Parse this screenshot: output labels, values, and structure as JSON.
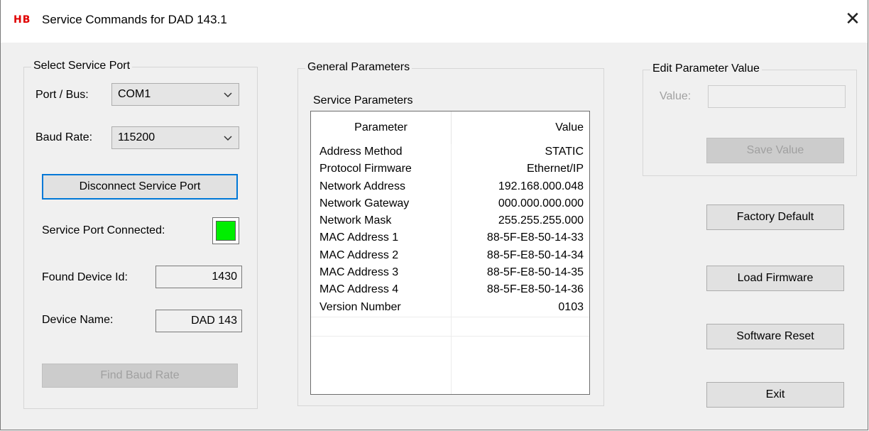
{
  "window": {
    "logo": "HB",
    "title": "Service Commands for DAD 143.1",
    "close_glyph": "✕"
  },
  "select_port": {
    "group_title": "Select Service Port",
    "port_label": "Port / Bus:",
    "port_value": "COM1",
    "baud_label": "Baud Rate:",
    "baud_value": "115200",
    "disconnect_label": "Disconnect Service Port",
    "connected_label": "Service Port Connected:",
    "connected_color": "#00ee00",
    "device_id_label": "Found Device Id:",
    "device_id_value": "1430",
    "device_name_label": "Device Name:",
    "device_name_value": "DAD 143",
    "find_baud_label": "Find Baud Rate"
  },
  "general": {
    "group_title": "General Parameters",
    "list_title": "Service Parameters",
    "columns": {
      "parameter": "Parameter",
      "value": "Value"
    },
    "rows": [
      {
        "parameter": "Address Method",
        "value": "STATIC"
      },
      {
        "parameter": "Protocol Firmware",
        "value": "Ethernet/IP"
      },
      {
        "parameter": "Network Address",
        "value": "192.168.000.048"
      },
      {
        "parameter": "Network Gateway",
        "value": "000.000.000.000"
      },
      {
        "parameter": "Network Mask",
        "value": "255.255.255.000"
      },
      {
        "parameter": "MAC Address 1",
        "value": "88-5F-E8-50-14-33"
      },
      {
        "parameter": "MAC Address 2",
        "value": "88-5F-E8-50-14-34"
      },
      {
        "parameter": "MAC Address 3",
        "value": "88-5F-E8-50-14-35"
      },
      {
        "parameter": "MAC Address 4",
        "value": "88-5F-E8-50-14-36"
      },
      {
        "parameter": "Version Number",
        "value": "0103"
      }
    ]
  },
  "edit": {
    "group_title": "Edit Parameter Value",
    "value_label": "Value:",
    "value_text": "",
    "save_label": "Save Value"
  },
  "actions": {
    "factory_default": "Factory Default",
    "load_firmware": "Load Firmware",
    "software_reset": "Software Reset",
    "exit": "Exit"
  }
}
